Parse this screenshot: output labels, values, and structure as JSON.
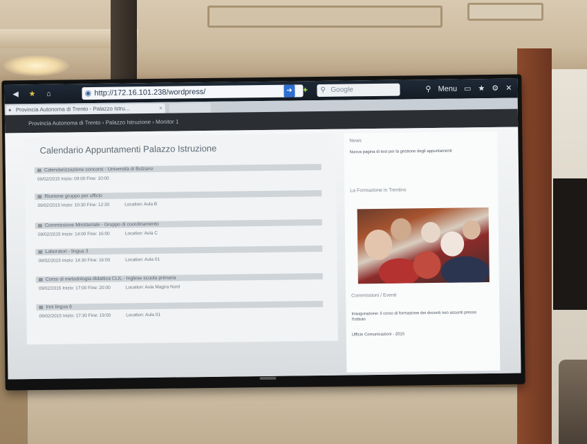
{
  "browser": {
    "url": "http://172.16.101.238/wordpress/",
    "search_placeholder": "Google",
    "tab_title": "Provincia Autonoma di Trento - Palazzo Istru...",
    "menu_label": "Menu"
  },
  "site": {
    "header_title": "Provincia Autonoma di Trento › Palazzo Istruzione › Monitor 1"
  },
  "main": {
    "title": "Calendario Appuntamenti Palazzo Istruzione",
    "appointments": [
      {
        "title": "Calendarizzazione concorsi - Università di Bolzano",
        "meta": "09/02/2015  Inizio: 09:00  Fine: 10:00"
      },
      {
        "title": "Riunione gruppo per ufficio",
        "meta": "09/02/2015  Inizio: 10:30  Fine: 12:30",
        "location": "Location: Aula B"
      },
      {
        "title": "Commissione Ministeriale - Gruppo di coordinamento",
        "meta": "09/02/2015  Inizio: 14:00  Fine: 16:00",
        "location": "Location: Aula C"
      },
      {
        "title": "Laboratori - lingua 3",
        "meta": "09/02/2015  Inizio: 14:30  Fine: 16:00",
        "location": "Location: Aula 01"
      },
      {
        "title": "Corso di metodologia didattica CLIL - Inglese scuola primaria",
        "meta": "09/02/2015  Inizio: 17:00  Fine: 20:00",
        "location": "Location: Aula Magna Nord"
      },
      {
        "title": "Inni lingua 6",
        "meta": "09/02/2015  Inizio: 17:30  Fine: 19:00",
        "location": "Location: Aula 01"
      }
    ]
  },
  "sidebar": {
    "news_heading": "News",
    "news_text": "Nuova pagina di test per la gestione degli appuntamenti",
    "photo_heading": "La Formazione in Trentino",
    "events_heading": "Commissioni / Eventi",
    "events_text_1": "Inaugurazione: il corso di formazione dei docenti neo assunti presso l'Istituto",
    "events_text_2": "Ufficio Comunicazioni - 2015"
  }
}
